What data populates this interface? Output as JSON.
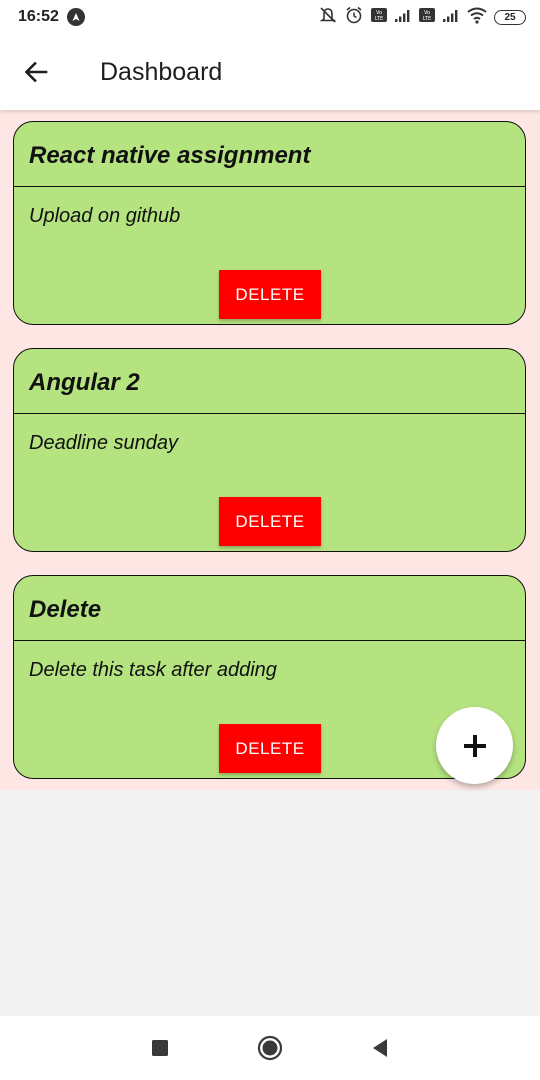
{
  "status_bar": {
    "time": "16:52",
    "battery": "25",
    "icons": [
      "navigation-icon",
      "mute-icon",
      "alarm-icon",
      "volte-icon",
      "signal-icon",
      "volte-icon",
      "signal-icon",
      "wifi-icon",
      "battery-icon"
    ]
  },
  "header": {
    "title": "Dashboard",
    "back_icon": "arrow-left-icon"
  },
  "tasks": [
    {
      "title": "React native assignment",
      "description": "Upload on github",
      "delete_label": "DELETE"
    },
    {
      "title": "Angular 2",
      "description": "Deadline sunday",
      "delete_label": "DELETE"
    },
    {
      "title": "Delete",
      "description": "Delete this task after adding",
      "delete_label": "DELETE"
    }
  ],
  "fab": {
    "icon": "plus-icon"
  },
  "nav_bar": {
    "icons": [
      "recent-apps-icon",
      "home-icon",
      "back-icon"
    ]
  },
  "colors": {
    "card_background": "#b5e380",
    "content_background": "#fde6e4",
    "delete_button": "#ff0000",
    "page_background": "#f2f2f2"
  }
}
